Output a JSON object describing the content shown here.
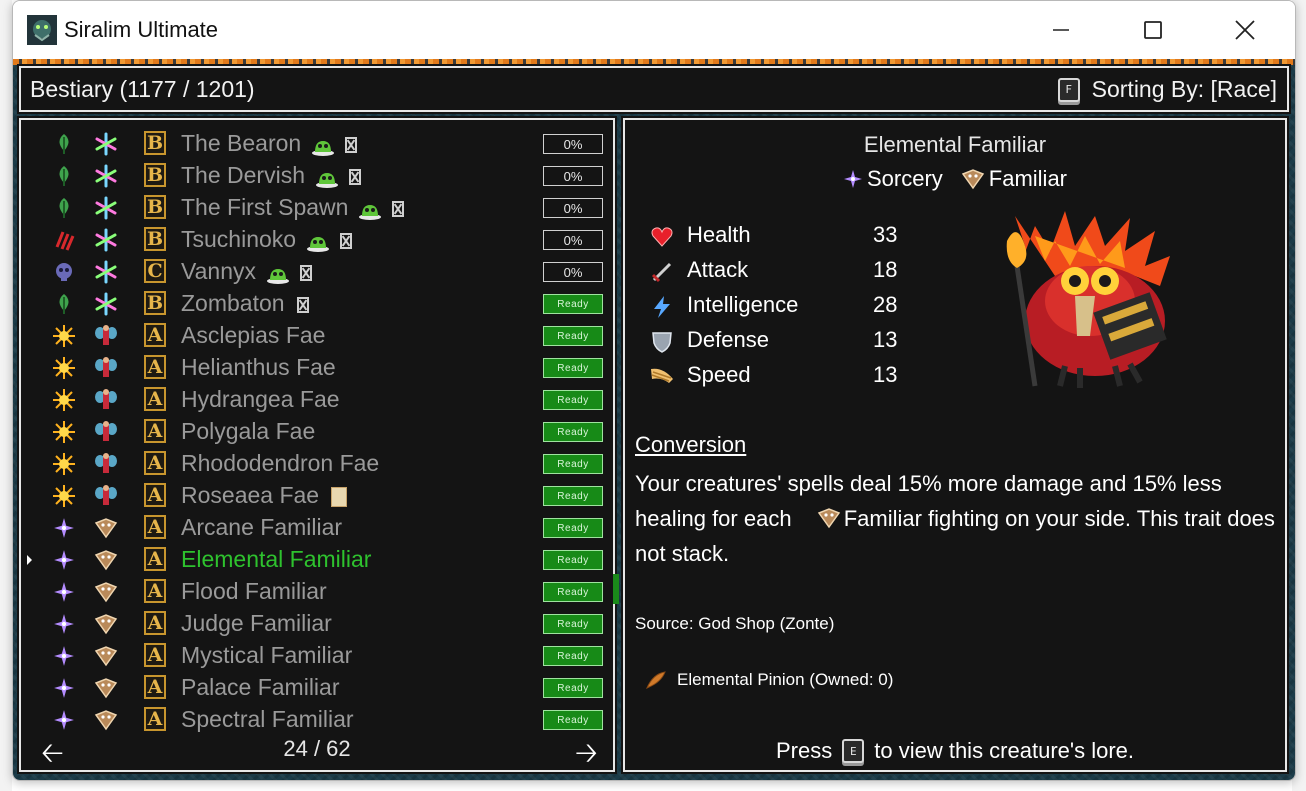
{
  "window": {
    "title": "Siralim Ultimate"
  },
  "header": {
    "title": "Bestiary (1177 / 1201)",
    "sort_key": "F",
    "sort_label": "Sorting By: [Race]"
  },
  "list": {
    "rows": [
      {
        "name": "The Bearon",
        "tier": "B",
        "icon_a": "leaf-icon",
        "icon_b": "chaos-star-icon",
        "trail": [
          "slime-icon",
          "x-box-icon"
        ],
        "status": "0%"
      },
      {
        "name": "The Dervish",
        "tier": "B",
        "icon_a": "leaf-icon",
        "icon_b": "chaos-star-icon",
        "trail": [
          "slime-icon",
          "x-box-icon"
        ],
        "status": "0%"
      },
      {
        "name": "The First Spawn",
        "tier": "B",
        "icon_a": "leaf-icon",
        "icon_b": "chaos-star-icon",
        "trail": [
          "slime-icon",
          "x-box-icon"
        ],
        "status": "0%"
      },
      {
        "name": "Tsuchinoko",
        "tier": "B",
        "icon_a": "claw-icon",
        "icon_b": "chaos-star-icon",
        "trail": [
          "slime-icon",
          "x-box-icon"
        ],
        "status": "0%"
      },
      {
        "name": "Vannyx",
        "tier": "C",
        "icon_a": "skull-icon",
        "icon_b": "chaos-star-icon",
        "trail": [
          "slime-icon",
          "x-box-icon"
        ],
        "status": "0%"
      },
      {
        "name": "Zombaton",
        "tier": "B",
        "icon_a": "leaf-icon",
        "icon_b": "chaos-star-icon",
        "trail": [
          "x-box-icon"
        ],
        "status": "Ready"
      },
      {
        "name": "Asclepias Fae",
        "tier": "A",
        "icon_a": "sun-icon",
        "icon_b": "fae-icon",
        "trail": [],
        "status": "Ready"
      },
      {
        "name": "Helianthus Fae",
        "tier": "A",
        "icon_a": "sun-icon",
        "icon_b": "fae-icon",
        "trail": [],
        "status": "Ready"
      },
      {
        "name": "Hydrangea Fae",
        "tier": "A",
        "icon_a": "sun-icon",
        "icon_b": "fae-icon",
        "trail": [],
        "status": "Ready"
      },
      {
        "name": "Polygala Fae",
        "tier": "A",
        "icon_a": "sun-icon",
        "icon_b": "fae-icon",
        "trail": [],
        "status": "Ready"
      },
      {
        "name": "Rhododendron Fae",
        "tier": "A",
        "icon_a": "sun-icon",
        "icon_b": "fae-icon",
        "trail": [],
        "status": "Ready"
      },
      {
        "name": "Roseaea Fae",
        "tier": "A",
        "icon_a": "sun-icon",
        "icon_b": "fae-icon",
        "trail": [
          "card-icon"
        ],
        "status": "Ready"
      },
      {
        "name": "Arcane Familiar",
        "tier": "A",
        "icon_a": "sorcery-icon",
        "icon_b": "familiar-icon",
        "trail": [],
        "status": "Ready"
      },
      {
        "name": "Elemental Familiar",
        "tier": "A",
        "icon_a": "sorcery-icon",
        "icon_b": "familiar-icon",
        "trail": [],
        "status": "Ready",
        "selected": true
      },
      {
        "name": "Flood Familiar",
        "tier": "A",
        "icon_a": "sorcery-icon",
        "icon_b": "familiar-icon",
        "trail": [],
        "status": "Ready"
      },
      {
        "name": "Judge Familiar",
        "tier": "A",
        "icon_a": "sorcery-icon",
        "icon_b": "familiar-icon",
        "trail": [],
        "status": "Ready"
      },
      {
        "name": "Mystical Familiar",
        "tier": "A",
        "icon_a": "sorcery-icon",
        "icon_b": "familiar-icon",
        "trail": [],
        "status": "Ready"
      },
      {
        "name": "Palace Familiar",
        "tier": "A",
        "icon_a": "sorcery-icon",
        "icon_b": "familiar-icon",
        "trail": [],
        "status": "Ready"
      },
      {
        "name": "Spectral Familiar",
        "tier": "A",
        "icon_a": "sorcery-icon",
        "icon_b": "familiar-icon",
        "trail": [],
        "status": "Ready"
      }
    ],
    "page": "24 / 62"
  },
  "detail": {
    "name": "Elemental Familiar",
    "class_label": "Sorcery",
    "race_label": "Familiar",
    "stats": [
      {
        "label": "Health",
        "value": "33",
        "icon": "heart-icon"
      },
      {
        "label": "Attack",
        "value": "18",
        "icon": "sword-icon"
      },
      {
        "label": "Intelligence",
        "value": "28",
        "icon": "lightning-icon"
      },
      {
        "label": "Defense",
        "value": "13",
        "icon": "shield-icon"
      },
      {
        "label": "Speed",
        "value": "13",
        "icon": "wing-icon"
      }
    ],
    "trait_title": "Conversion",
    "trait_text_1": "Your creatures' spells deal 15% more damage and 15% less healing for each",
    "trait_text_2": "Familiar fighting on your side. This trait does not stack.",
    "source": "Source: God Shop (Zonte)",
    "item": "Elemental Pinion (Owned: 0)",
    "lore_pre": "Press",
    "lore_key": "E",
    "lore_post": "to view this creature's lore."
  },
  "colors": {
    "selected": "#2ec22e",
    "ready_bg": "#178a17",
    "tier_border": "#c8962e"
  }
}
